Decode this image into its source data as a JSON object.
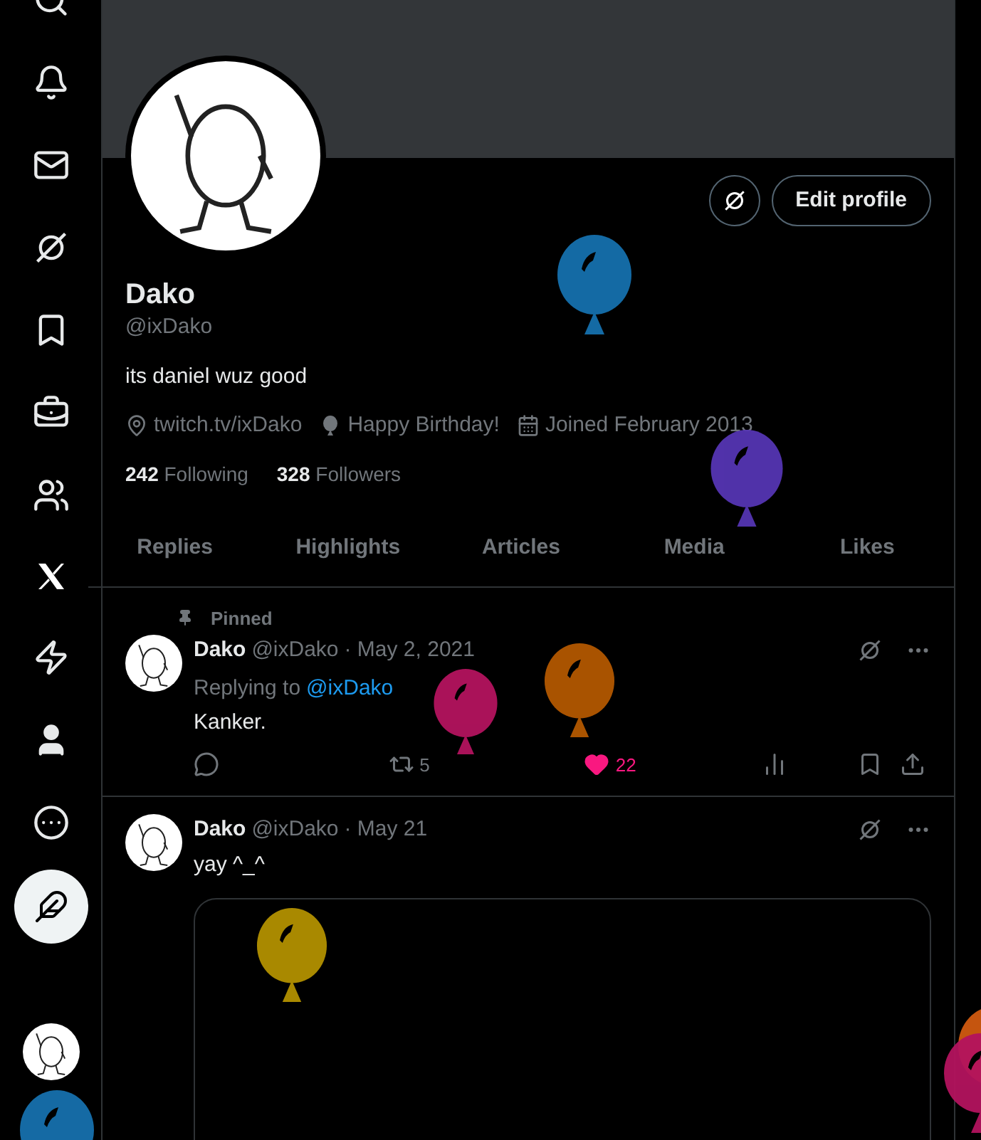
{
  "profile": {
    "name": "Dako",
    "handle": "@ixDako",
    "bio": "its daniel wuz good",
    "edit_button": "Edit profile",
    "meta": [
      {
        "kind": "location",
        "text": "twitch.tv/ixDako"
      },
      {
        "kind": "birthday",
        "text": "Happy Birthday!"
      },
      {
        "kind": "joined",
        "text": "Joined February 2013"
      }
    ],
    "counts": [
      {
        "number": "242",
        "label": "Following"
      },
      {
        "number": "328",
        "label": "Followers"
      }
    ]
  },
  "tabs": [
    {
      "label": "Replies",
      "selected": false
    },
    {
      "label": "Highlights",
      "selected": false
    },
    {
      "label": "Articles",
      "selected": false
    },
    {
      "label": "Media",
      "selected": false
    },
    {
      "label": "Likes",
      "selected": false
    }
  ],
  "posts": [
    {
      "pinned_label": "Pinned",
      "name": "Dako",
      "handle": "@ixDako",
      "date": "· May 2, 2021",
      "reply_prefix": "Replying to",
      "reply_to": "@ixDako",
      "text": "Kanker.",
      "actions": {
        "retweets": "5",
        "likes": "22",
        "liked": true
      },
      "has_media": false
    },
    {
      "name": "Dako",
      "handle": "@ixDako",
      "date": "· May 21",
      "text": "yay ^_^",
      "has_media": true
    }
  ],
  "balloons": [
    {
      "color": "#1670ad"
    },
    {
      "color": "#5535b3"
    },
    {
      "color": "#b3135e"
    },
    {
      "color": "#b35800"
    },
    {
      "color": "#b39100"
    },
    {
      "color": "#1670ad"
    },
    {
      "color": "#d05a10"
    },
    {
      "color": "#b3135e"
    }
  ]
}
